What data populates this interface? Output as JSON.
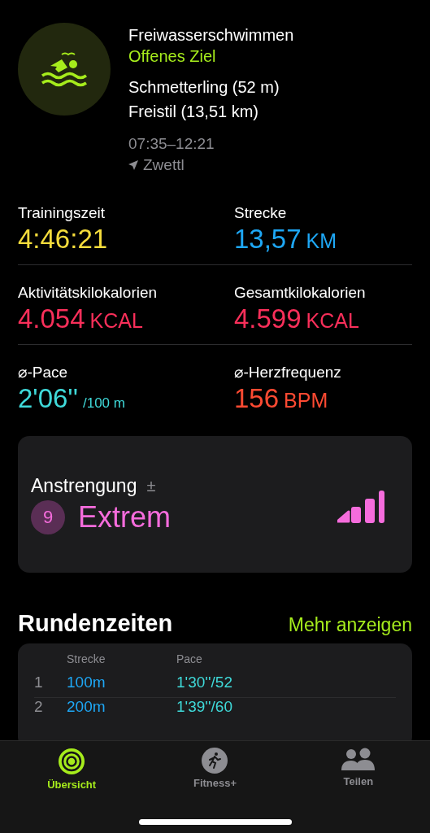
{
  "workout": {
    "title": "Freiwasserschwimmen",
    "goal": "Offenes Ziel",
    "strokes": [
      "Schmetterling (52 m)",
      "Freistil (13,51 km)"
    ],
    "time": "07:35–12:21",
    "location": "Zwettl"
  },
  "metrics": [
    {
      "label": "Trainingszeit",
      "value": "4:46:21",
      "color": "#f5dc3c"
    },
    {
      "label": "Strecke",
      "value": "13,57",
      "unit": "KM",
      "color": "#1ea7f5"
    },
    {
      "label": "Aktivitätskilokalorien",
      "value": "4.054",
      "unit": "KCAL",
      "color": "#fa2f5a"
    },
    {
      "label": "Gesamtkilokalorien",
      "value": "4.599",
      "unit": "KCAL",
      "color": "#fa2f5a"
    },
    {
      "label": "⌀-Pace",
      "value": "2'06''",
      "unit": "/100 m",
      "color": "#3fd9d9"
    },
    {
      "label": "⌀-Herzfrequenz",
      "value": "156",
      "unit": "BPM",
      "color": "#ff4a32"
    }
  ],
  "effort": {
    "label": "Anstrengung",
    "adjust": "±",
    "score": "9",
    "rating": "Extrem",
    "level": 0.9
  },
  "laps": {
    "title": "Rundenzeiten",
    "more": "Mehr anzeigen",
    "columns": [
      "Strecke",
      "Pace"
    ],
    "rows": [
      {
        "index": "1",
        "distance": "100m",
        "pace": "1'30''/52"
      },
      {
        "index": "2",
        "distance": "200m",
        "pace": "1'39''/60"
      }
    ]
  },
  "tabs": [
    {
      "label": "Übersicht",
      "kind": "rings",
      "selected": true
    },
    {
      "label": "Fitness+",
      "kind": "runner",
      "selected": false
    },
    {
      "label": "Teilen",
      "kind": "people",
      "selected": false
    }
  ]
}
